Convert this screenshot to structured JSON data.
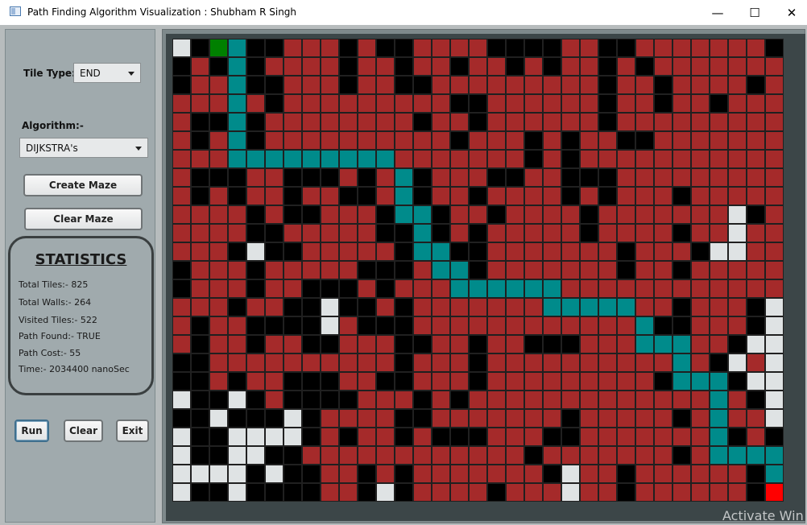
{
  "window": {
    "title": "Path Finding Algorithm Visualization : Shubham R Singh",
    "minimize_glyph": "—",
    "maximize_glyph": "☐",
    "close_glyph": "✕"
  },
  "controls": {
    "tile_type_label": "Tile Type:-",
    "tile_type_value": "END",
    "algorithm_label": "Algorithm:-",
    "algorithm_value": "DIJKSTRA's",
    "create_maze_label": "Create Maze",
    "clear_maze_label": "Clear Maze",
    "run_label": "Run",
    "clear_label": "Clear",
    "exit_label": "Exit"
  },
  "stats": {
    "title": "STATISTICS",
    "total_tiles": "Total Tiles:-  825",
    "total_walls": "Total Walls:- 264",
    "visited_tiles": "Visited Tiles:- 522",
    "path_found": "Path Found:-  TRUE",
    "path_cost": "Path Cost:-  55",
    "time": "Time:-   2034400 nanoSec"
  },
  "grid": {
    "cols": 33,
    "rows": 25,
    "legend": {
      "W": "wall",
      "V": "visited",
      "P": "path",
      "E": "empty",
      "S": "start",
      "X": "end"
    },
    "colors": {
      "W": "#000000",
      "V": "#a52a2a",
      "P": "#008b8b",
      "E": "#dfe3e4",
      "S": "#008000",
      "X": "#ff0000"
    },
    "rows_data": [
      "EWSPWWVVVWVWWVVVVWWWWVVWWVVVVVVVW",
      "WVWPWVVVVWVVWVVWVVWVWVVWVWVVVVVVV",
      "WVVPWWVVVWVVWWVVVVVVVVVWVVWVVVVWV",
      "VVVPVWVVVVVVVVVWWVVVVVVWVVWVVWVVV",
      "VWWPWVVVVVVVVWVVWVVVVVVWVVVVVVVVV",
      "VWVPWVVVVVVVVVVWVVVWVWVVWWVVVVVVV",
      "VVVPPPPPPPPPVVVVVVVWVWVVVVVVVVVVV",
      "VWWWVVWWWVWVPWVVVWWVVWWWVVVVVVVVV",
      "VWVWVVWVVWWVPWVVWVVVVWVWVVVWVVVVV",
      "VVVVWVWWVVVWPPWVVWVVVVWVVVVVVVEWV",
      "VVVVWWVVVVVWWPWVWVVVVVWVVVVWVVEVV",
      "VVVWEWWVVVVVWPPWWVVVVVVVWVVVWEEVV",
      "WVVVWVVVVVWWWVPPWVVVVVVVWVVWVVVVV",
      "WVVVWVVWWWVWVVVPPPPPPVVVVVVVVVVVV",
      "VVVWVVWWEWWVWVVVVVVVPPPPPVVWVVVWE",
      "VWVVWWWWEVWWWVVVVVVVVVVVVPWWVVVWE",
      "VWVVWVVWWVVVWWVVWVVWWWVVVPPPVVWEE",
      "WWVVVVVVVVVVWVVVWVVVVVVVVVVPVWEVE",
      "WWVWVVWWWVVWWVVVWVVVVVVVVVWPPPWEE",
      "EWWEWVWWWWVVVWVWVVVVVVVVVVVVVPVWE",
      "WWEWWWEWVVVVWWVVVVVVVWVVVVVWVPVVE",
      "EWWEEEEWVWVVWVWWWVVVWWVVVVVVVPWVW",
      "EWWEEWWVVVVVVVVVVVVWVVVVVVVWVPPPP",
      "EEEEWEWWVVWVWVVVVVVVWEVVWVVVVVVWP",
      "EWWEWWWWVVWEWVVVVWVVVEVVWVVVVVVWX"
    ]
  }
}
